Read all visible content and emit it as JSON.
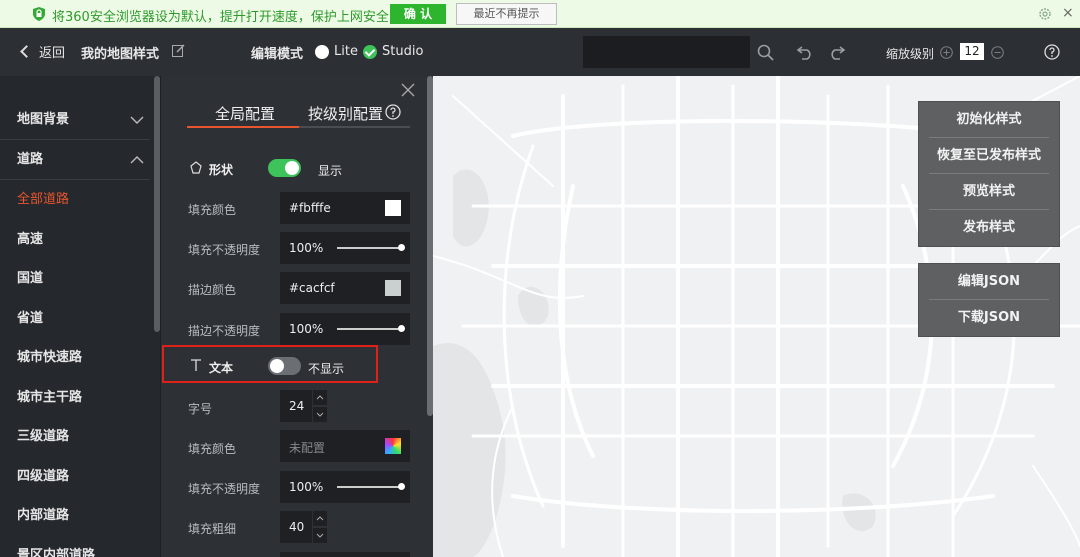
{
  "notify": {
    "message": "将360安全浏览器设为默认，提升打开速度，保护上网安全",
    "confirm": "确 认",
    "dismiss": "最近不再提示",
    "close": "×"
  },
  "toolbar": {
    "back": "返回",
    "title": "我的地图样式",
    "mode_label": "编辑模式",
    "mode_lite": "Lite",
    "mode_studio": "Studio",
    "selected_mode": "Studio",
    "search_value": "",
    "zoom_label": "缩放级别",
    "zoom_value": "12"
  },
  "sidebar": {
    "items": [
      {
        "label": "地图背景",
        "type": "header",
        "expanded": false
      },
      {
        "label": "道路",
        "type": "header",
        "expanded": true
      },
      {
        "label": "全部道路",
        "type": "child",
        "active": true
      },
      {
        "label": "高速",
        "type": "child"
      },
      {
        "label": "国道",
        "type": "child"
      },
      {
        "label": "省道",
        "type": "child"
      },
      {
        "label": "城市快速路",
        "type": "child"
      },
      {
        "label": "城市主干路",
        "type": "child"
      },
      {
        "label": "三级道路",
        "type": "child"
      },
      {
        "label": "四级道路",
        "type": "child"
      },
      {
        "label": "内部道路",
        "type": "child"
      },
      {
        "label": "景区内部道路",
        "type": "child"
      }
    ]
  },
  "panel": {
    "tab_global": "全局配置",
    "tab_level": "按级别配置",
    "shape": {
      "label": "形状",
      "toggle_on": true,
      "state": "显示"
    },
    "fill_color": {
      "label": "填充颜色",
      "value": "#fbfffe",
      "swatch": "#ffffff"
    },
    "fill_opacity": {
      "label": "填充不透明度",
      "value": "100%",
      "level": 1.0
    },
    "stroke_color": {
      "label": "描边颜色",
      "value": "#cacfcf",
      "swatch": "#cacfcf"
    },
    "stroke_opacity": {
      "label": "描边不透明度",
      "value": "100%",
      "level": 1.0
    },
    "text": {
      "label": "文本",
      "toggle_on": false,
      "state": "不显示"
    },
    "font_size": {
      "label": "字号",
      "value": "24"
    },
    "text_fill_color": {
      "label": "填充颜色",
      "placeholder": "未配置"
    },
    "text_fill_opacity": {
      "label": "填充不透明度",
      "value": "100%",
      "level": 1.0
    },
    "text_weight": {
      "label": "填充粗细",
      "value": "40"
    }
  },
  "map_tools": {
    "group1": [
      "初始化样式",
      "恢复至已发布样式",
      "预览样式",
      "发布样式"
    ],
    "group2": [
      "编辑JSON",
      "下载JSON"
    ]
  },
  "colors": {
    "accent": "#e8552f",
    "toggle_on": "#3dc35a",
    "toolbar_bg": "#2c2f34",
    "highlight": "#e0211a"
  }
}
